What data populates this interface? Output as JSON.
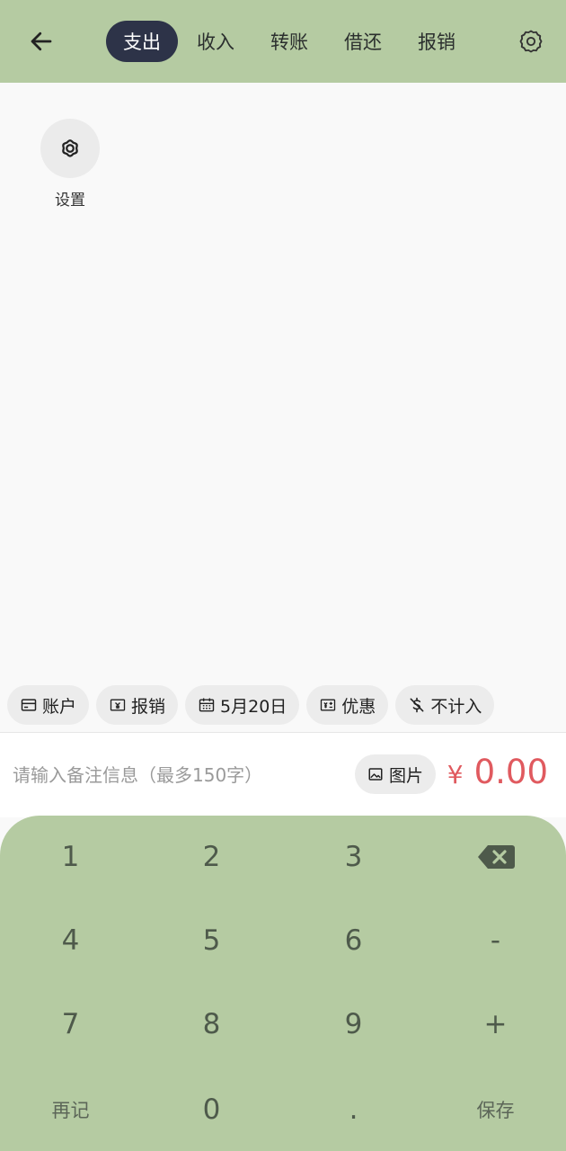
{
  "header": {
    "back_icon": "arrow-left-icon",
    "tabs": [
      {
        "label": "支出",
        "active": true
      },
      {
        "label": "收入",
        "active": false
      },
      {
        "label": "转账",
        "active": false
      },
      {
        "label": "借还",
        "active": false
      },
      {
        "label": "报销",
        "active": false
      }
    ],
    "settings_icon": "gear-icon"
  },
  "categories": [
    {
      "label": "设置",
      "icon": "gear-icon"
    }
  ],
  "chips": {
    "account": "账户",
    "reimburse": "报销",
    "date": "5月20日",
    "discount": "优惠",
    "exclude": "不计入"
  },
  "note": {
    "placeholder": "请输入备注信息（最多150字）",
    "value": "",
    "photo_label": "图片"
  },
  "amount": {
    "currency": "¥",
    "value": "0.00"
  },
  "keypad": {
    "k1": "1",
    "k2": "2",
    "k3": "3",
    "backspace_icon": "backspace-icon",
    "k4": "4",
    "k5": "5",
    "k6": "6",
    "minus": "-",
    "k7": "7",
    "k8": "8",
    "k9": "9",
    "plus": "+",
    "again": "再记",
    "k0": "0",
    "dot": ".",
    "save": "保存"
  },
  "colors": {
    "header_bg": "#b5cba2",
    "active_tab_bg": "#2d3348",
    "amount": "#e05a5f",
    "keypad_bg": "#b5cba2"
  }
}
